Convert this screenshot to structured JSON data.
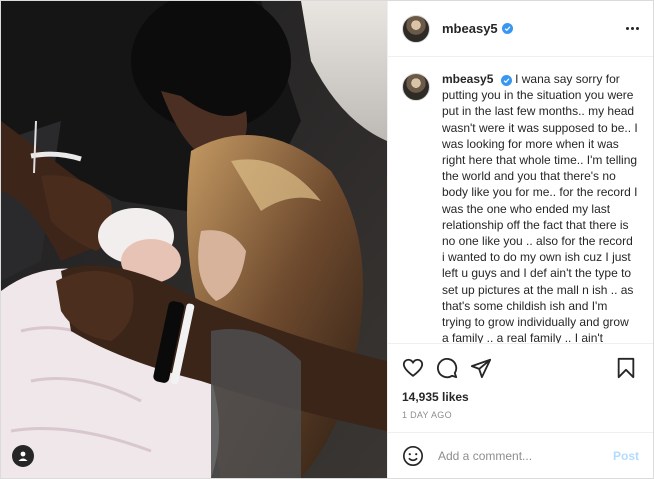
{
  "post": {
    "username": "mbeasy5",
    "verified": true,
    "caption": "I wana say sorry for putting you in the situation you were put in the last few months.. my head wasn't were it was supposed to be.. I was looking for more when it was right here that whole time.. I'm telling the world and you that there's no body like you for me.. for the record I was the one who ended my last relationship off the fact that there is no one like you .. also for the record i wanted to do my own ish cuz I just left u guys and I def ain't the type to set up pictures at the mall n ish .. as that's some childish ish and I'm trying to grow individually and grow a family .. a real family .. I ain't looking to be judged I'm looking for forgiveness.. To forgive me for hurting my family the way I did. At",
    "likes": "14,935 likes",
    "time_ago": "1 DAY AGO"
  },
  "icons": {
    "like": "heart-icon",
    "comment": "comment-icon",
    "share": "share-icon",
    "save": "bookmark-icon",
    "more": "more-options-icon",
    "emoji": "emoji-icon",
    "user_tag": "user-tag-icon"
  },
  "comment_box": {
    "placeholder": "Add a comment...",
    "post_label": "Post"
  },
  "colors": {
    "verified": "#3897f0",
    "post_button_disabled": "#b3dbff",
    "border": "#dbdbdb",
    "muted_text": "#8e8e8e"
  }
}
